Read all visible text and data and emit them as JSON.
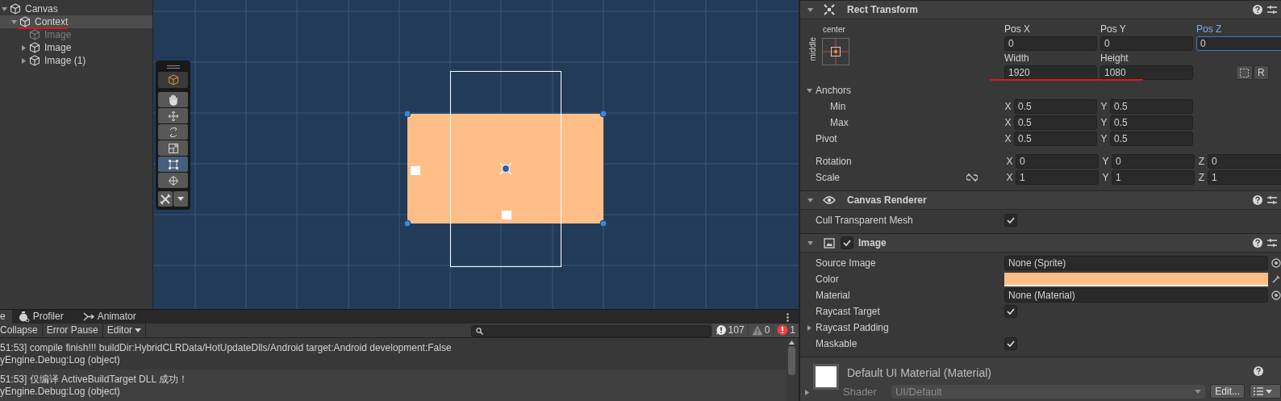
{
  "hierarchy": {
    "items": [
      {
        "name": "Canvas",
        "kind": "parent",
        "expanded": true,
        "selected": false,
        "active": true,
        "underlined": false,
        "children": [
          {
            "name": "Context",
            "kind": "parent",
            "expanded": true,
            "selected": true,
            "active": true,
            "underlined": true,
            "children": [
              {
                "name": "Image",
                "kind": "leaf",
                "expanded": false,
                "selected": false,
                "active": false,
                "underlined": false
              },
              {
                "name": "Image",
                "kind": "parent",
                "expanded": false,
                "selected": false,
                "active": true,
                "underlined": false
              },
              {
                "name": "Image (1)",
                "kind": "parent",
                "expanded": false,
                "selected": false,
                "active": true,
                "underlined": false
              }
            ]
          }
        ]
      }
    ]
  },
  "scene": {
    "tools": [
      {
        "kind": "view",
        "selected": false
      },
      {
        "kind": "hand",
        "selected": false
      },
      {
        "kind": "move",
        "selected": false
      },
      {
        "kind": "rotate",
        "selected": false
      },
      {
        "kind": "scale",
        "selected": false
      },
      {
        "kind": "rect",
        "selected": true
      },
      {
        "kind": "transform",
        "selected": false
      }
    ]
  },
  "console": {
    "tabs": [
      {
        "label": "e",
        "selected": true
      },
      {
        "label": "Profiler",
        "selected": false
      },
      {
        "label": "Animator",
        "selected": false
      }
    ],
    "buttons": [
      {
        "label": "Collapse",
        "kind": "toggle"
      },
      {
        "label": "Error Pause",
        "kind": "toggle"
      },
      {
        "label": "Editor",
        "kind": "dropdown"
      }
    ],
    "counters": [
      {
        "kind": "info",
        "count": "107"
      },
      {
        "kind": "warning",
        "count": "0"
      },
      {
        "kind": "error",
        "count": "1"
      }
    ],
    "logs": [
      {
        "message": "51:53] compile finish!!! buildDir:HybridCLRData/HotUpdateDlls/Android target:Android development:False",
        "trace": "yEngine.Debug:Log (object)"
      },
      {
        "message": "51:53] 仅编译 ActiveBuildTarget DLL 成功！",
        "trace": "yEngine.Debug:Log (object)"
      }
    ]
  },
  "inspector": {
    "rect_transform": {
      "title": "Rect Transform",
      "expanded": true,
      "anchor_h": "center",
      "anchor_v": "middle",
      "position": [
        {
          "label": "Pos X",
          "value": "0",
          "focused": false
        },
        {
          "label": "Pos Y",
          "value": "0",
          "focused": false
        },
        {
          "label": "Pos Z",
          "value": "0",
          "focused": true
        }
      ],
      "size": [
        {
          "label": "Width",
          "value": "1920"
        },
        {
          "label": "Height",
          "value": "1080"
        }
      ],
      "size_underlined": true,
      "raw_button": "R",
      "anchors": {
        "label": "Anchors",
        "expanded": true,
        "rows": [
          {
            "label": "Min",
            "fields": [
              {
                "axis": "X",
                "value": "0.5"
              },
              {
                "axis": "Y",
                "value": "0.5"
              }
            ]
          },
          {
            "label": "Max",
            "fields": [
              {
                "axis": "X",
                "value": "0.5"
              },
              {
                "axis": "Y",
                "value": "0.5"
              }
            ]
          }
        ]
      },
      "vectors": [
        {
          "label": "Pivot",
          "kind": "vector",
          "fields": [
            {
              "axis": "X",
              "value": "0.5"
            },
            {
              "axis": "Y",
              "value": "0.5"
            }
          ]
        },
        {
          "label": "Rotation",
          "kind": "vector",
          "fields": [
            {
              "axis": "X",
              "value": "0"
            },
            {
              "axis": "Y",
              "value": "0"
            },
            {
              "axis": "Z",
              "value": "0"
            }
          ]
        },
        {
          "label": "Scale",
          "kind": "scale",
          "fields": [
            {
              "axis": "X",
              "value": "1"
            },
            {
              "axis": "Y",
              "value": "1"
            },
            {
              "axis": "Z",
              "value": "1"
            }
          ]
        }
      ]
    },
    "components": [
      {
        "title": "Canvas Renderer",
        "expanded": true,
        "properties": [
          {
            "label": "Cull Transparent Mesh",
            "kind": "checkbox",
            "checked": true
          }
        ]
      },
      {
        "title": "Image",
        "expanded": true,
        "enabled": true,
        "properties": [
          {
            "label": "Source Image",
            "kind": "object",
            "value": "None (Sprite)"
          },
          {
            "label": "Color",
            "kind": "color",
            "color": "#ffbe88"
          },
          {
            "label": "Material",
            "kind": "object",
            "value": "None (Material)"
          },
          {
            "label": "Raycast Target",
            "kind": "checkbox",
            "checked": true
          },
          {
            "label": "Raycast Padding",
            "kind": "foldout",
            "expanded": false
          },
          {
            "label": "Maskable",
            "kind": "checkbox",
            "checked": true
          }
        ]
      }
    ],
    "material": {
      "title": "Default UI Material (Material)",
      "shader_label": "Shader",
      "shader": "UI/Default",
      "edit_button": "Edit..."
    }
  }
}
